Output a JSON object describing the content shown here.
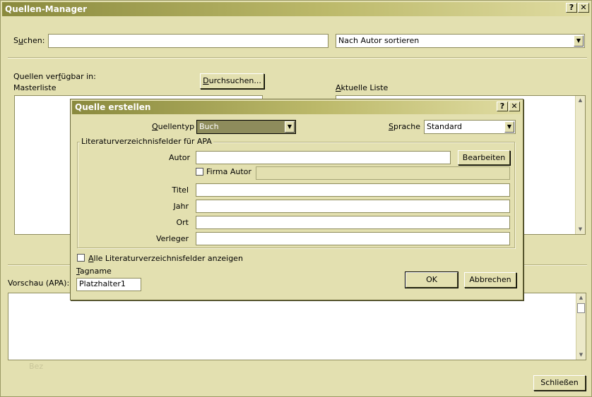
{
  "window": {
    "title": "Quellen-Manager",
    "help_btn": "?",
    "close_btn": "✕"
  },
  "search": {
    "label_pre": "S",
    "label_u": "u",
    "label_post": "chen:",
    "value": "",
    "sort_selected": "Nach Autor sortieren"
  },
  "sources": {
    "available_label_pre": "Quellen ver",
    "available_label_u": "f",
    "available_label_post": "ügbar in:",
    "master_label": "Masterliste",
    "browse_pre": "",
    "browse_u": "D",
    "browse_post": "urchsuchen...",
    "current_label_u": "A",
    "current_label_post": "ktuelle Liste"
  },
  "preview": {
    "label": "Vorschau (APA):",
    "ghost": "Bez"
  },
  "close_button": "Schließen",
  "dialog": {
    "title": "Quelle erstellen",
    "help_btn": "?",
    "close_btn": "✕",
    "type_label_pre": "",
    "type_label_u": "Q",
    "type_label_post": "uellentyp",
    "type_value": "Buch",
    "lang_label_u": "S",
    "lang_label_post": "prache",
    "lang_value": "Standard",
    "group_label": "Literaturverzeichnisfelder für APA",
    "fields": {
      "autor_label": "Autor",
      "autor_value": "",
      "edit_button": "Bearbeiten",
      "corp_author_label": "Firma Autor",
      "titel_label": "Titel",
      "jahr_label": "Jahr",
      "ort_label": "Ort",
      "verleger_label": "Verleger"
    },
    "show_all_u": "A",
    "show_all_post": "lle Literaturverzeichnisfelder anzeigen",
    "tag_label_u": "T",
    "tag_label_post": "agname",
    "tag_value": "Platzhalter1",
    "ok_button": "OK",
    "cancel_button": "Abbrechen"
  }
}
